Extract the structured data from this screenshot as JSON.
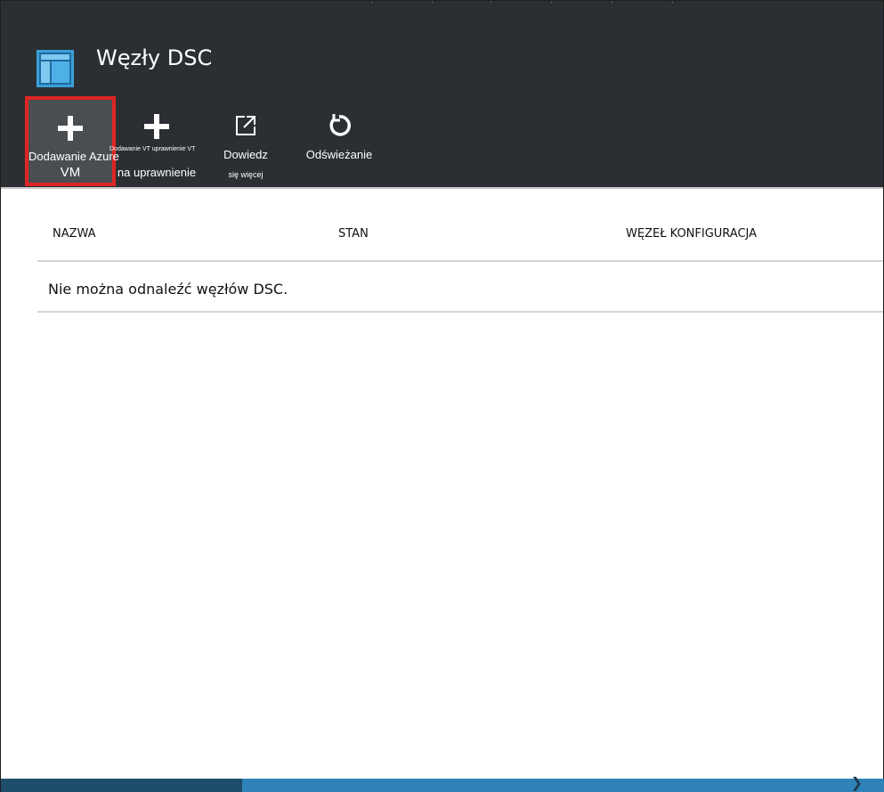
{
  "blade": {
    "title": "Węzły DSC",
    "icon": "blade-icon"
  },
  "commands": {
    "add_azure": {
      "label_line1": "Dodawanie Azure",
      "label_line2": "VM",
      "icon": "plus-icon"
    },
    "add_onprem": {
      "tiny_label": "Dodawanie VT uprawnienie VT",
      "label": "na uprawnienie",
      "icon": "plus-icon"
    },
    "learn_more": {
      "label": "Dowiedz",
      "sub_label": "się więcej",
      "icon": "external-link-icon"
    },
    "refresh": {
      "label": "Odświeżanie",
      "icon": "refresh-icon"
    }
  },
  "grid": {
    "columns": [
      "NAZWA",
      "STAN",
      "WĘZEŁ KONFIGURACJA"
    ],
    "empty_message": "Nie można odnaleźć węzłów DSC."
  },
  "colors": {
    "header_bg": "#2b2f33",
    "highlight_border": "#e02424",
    "accent_blue": "#2f83b8"
  }
}
